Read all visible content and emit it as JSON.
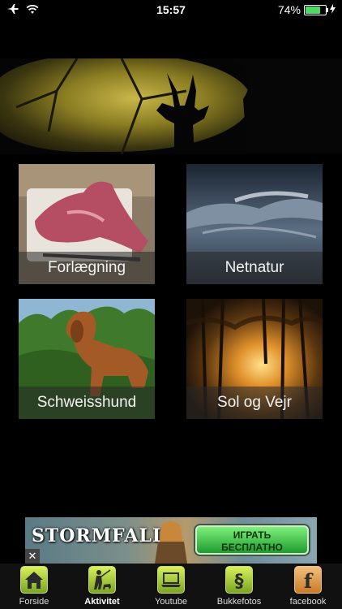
{
  "status_bar": {
    "time": "15:57",
    "battery_percent": "74%",
    "battery_level": 0.74
  },
  "tiles": [
    {
      "label": "Forlægning"
    },
    {
      "label": "Netnatur"
    },
    {
      "label": "Schweisshund"
    },
    {
      "label": "Sol og Vejr"
    }
  ],
  "ad": {
    "brand": "STORMFALL",
    "cta_line1": "ИГРАТЬ",
    "cta_line2": "БЕСПЛАТНО",
    "close": "✕"
  },
  "tab_bar": {
    "items": [
      {
        "label": "Forside"
      },
      {
        "label": "Aktivitet"
      },
      {
        "label": "Youtube"
      },
      {
        "label": "Bukkefotos"
      },
      {
        "label": "facebook"
      }
    ],
    "active_index": 1
  },
  "colors": {
    "accent_green": "#7aa524",
    "facebook_orange": "#c97a28",
    "battery_green": "#4cd964"
  }
}
